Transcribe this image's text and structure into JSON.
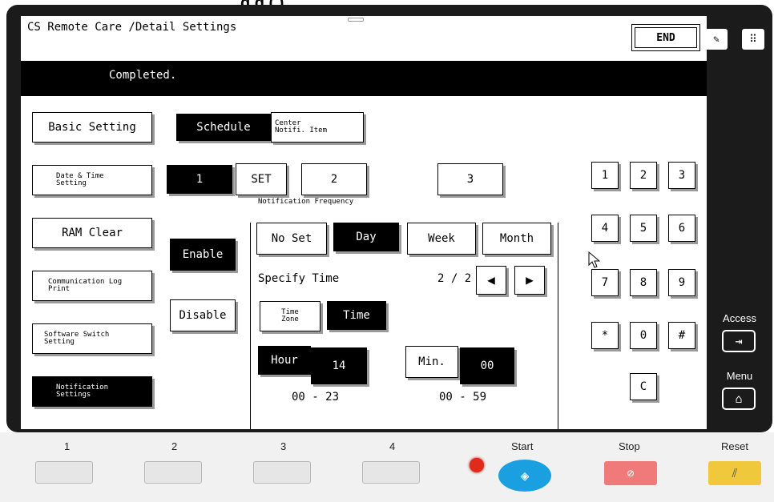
{
  "top_cut_text": "g                 g (    )",
  "header": {
    "title": "CS Remote Care  /Detail Settings",
    "end_label": "END"
  },
  "message": "Completed.",
  "left_menu": [
    {
      "label": "Basic Setting",
      "selected": false,
      "small": false
    },
    {
      "label": "Date & Time Setting",
      "selected": false,
      "small": true
    },
    {
      "label": "RAM Clear",
      "selected": false,
      "small": false
    },
    {
      "label": "Communication Log Print",
      "selected": false,
      "small": true
    },
    {
      "label": "Software Switch Setting",
      "selected": false,
      "small": true
    },
    {
      "label": "Notification Settings",
      "selected": true,
      "small": true
    }
  ],
  "tabs": {
    "schedule": "Schedule",
    "center_notifi": "Center Notifi. Item"
  },
  "schedule_slots": {
    "one": "1",
    "set": "SET",
    "two": "2",
    "three": "3"
  },
  "enable_label": "Enable",
  "disable_label": "Disable",
  "notification_frequency_label": "Notification Frequency",
  "frequency": {
    "no_set": "No Set",
    "day": "Day",
    "week": "Week",
    "month": "Month",
    "selected": "Day"
  },
  "specify_time_label": "Specify Time",
  "page_indicator": "2 / 2",
  "time_zone_label": "Time Zone",
  "time_label": "Time",
  "hour_label": "Hour",
  "hour_value": "14",
  "hour_range": "00 - 23",
  "min_label": "Min.",
  "min_value": "00",
  "min_range": "00 - 59",
  "keypad": [
    "1",
    "2",
    "3",
    "4",
    "5",
    "6",
    "7",
    "8",
    "9",
    "*",
    "0",
    "#"
  ],
  "clear_label": "C",
  "side": {
    "access_label": "Access",
    "menu_label": "Menu"
  },
  "panel": {
    "keys": [
      "1",
      "2",
      "3",
      "4"
    ],
    "start_label": "Start",
    "stop_label": "Stop",
    "reset_label": "Reset"
  },
  "colors": {
    "start": "#1aa0e0",
    "stop": "#f07a7a",
    "reset": "#f0c83c",
    "indicator": "#e02a1a"
  }
}
